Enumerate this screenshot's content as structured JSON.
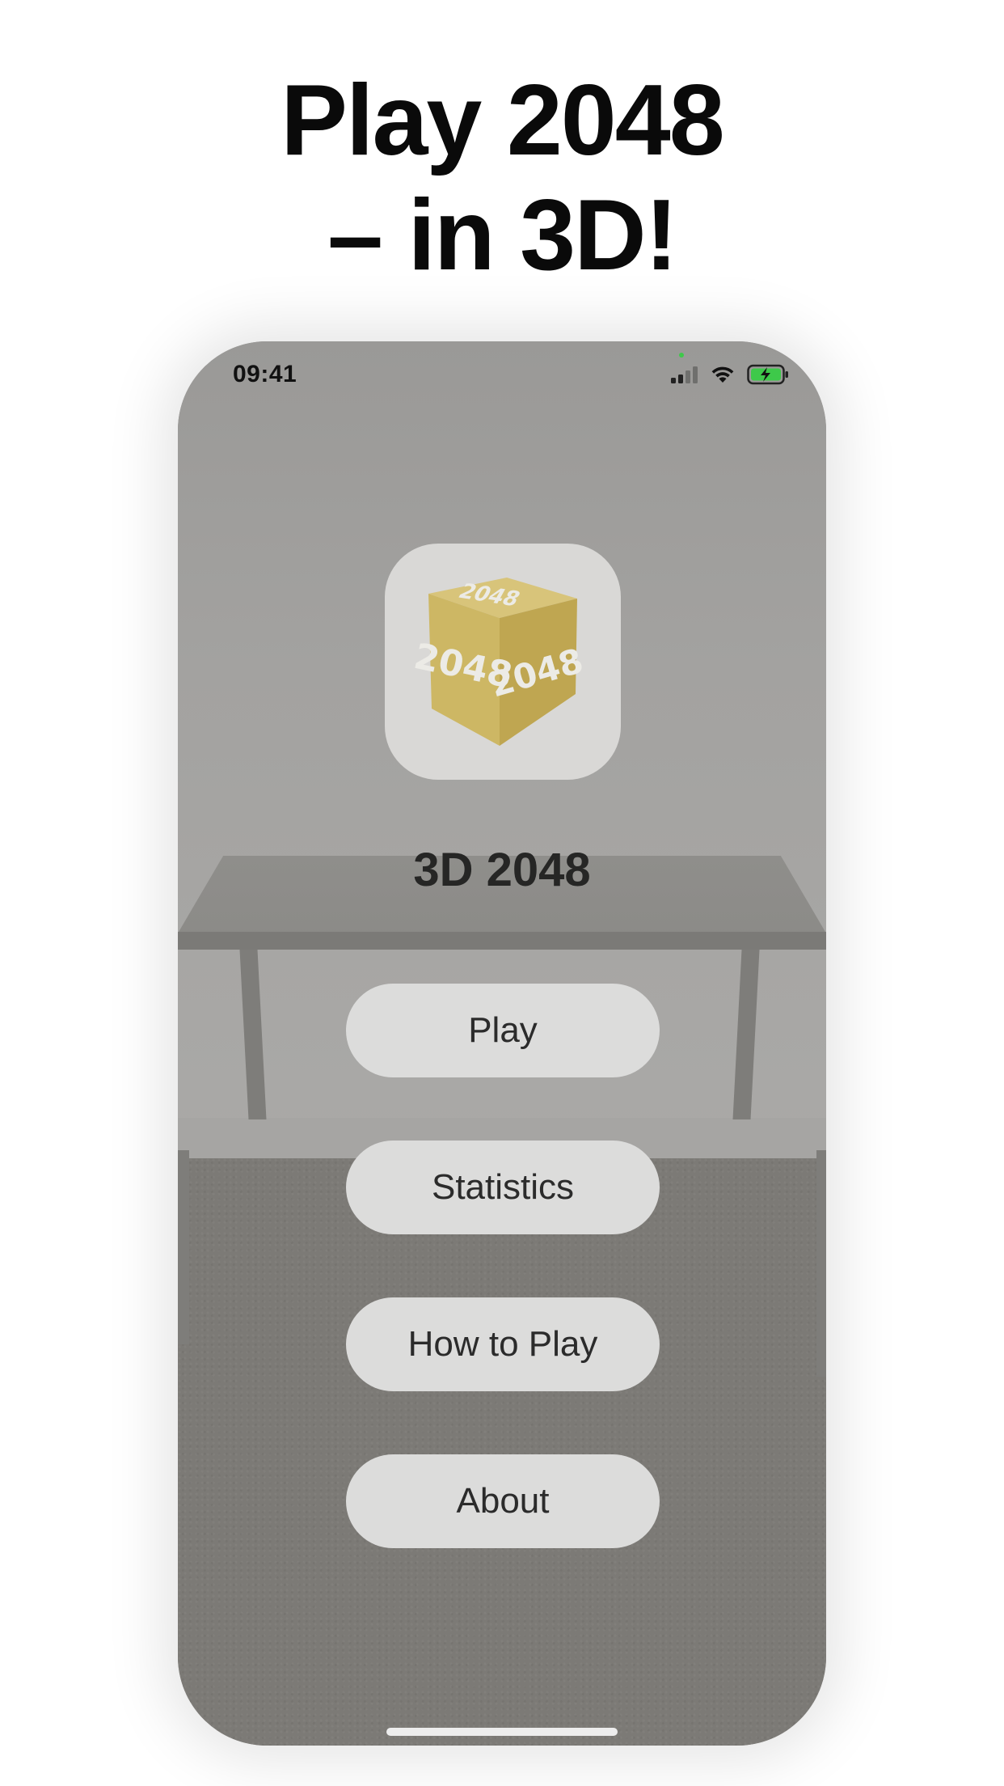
{
  "headline": {
    "line1": "Play 2048",
    "line2": "– in 3D!"
  },
  "status_bar": {
    "time": "09:41",
    "icons": [
      "cellular-signal-icon",
      "wifi-icon",
      "battery-charging-icon"
    ],
    "battery_color": "#3ec94a"
  },
  "app": {
    "icon_name": "2048-cube-icon",
    "cube_labels": [
      "2048",
      "2048",
      "2048"
    ],
    "cube_color": "#c9b461",
    "title": "3D 2048"
  },
  "menu": {
    "play": "Play",
    "statistics": "Statistics",
    "how_to_play": "How to Play",
    "about": "About"
  }
}
